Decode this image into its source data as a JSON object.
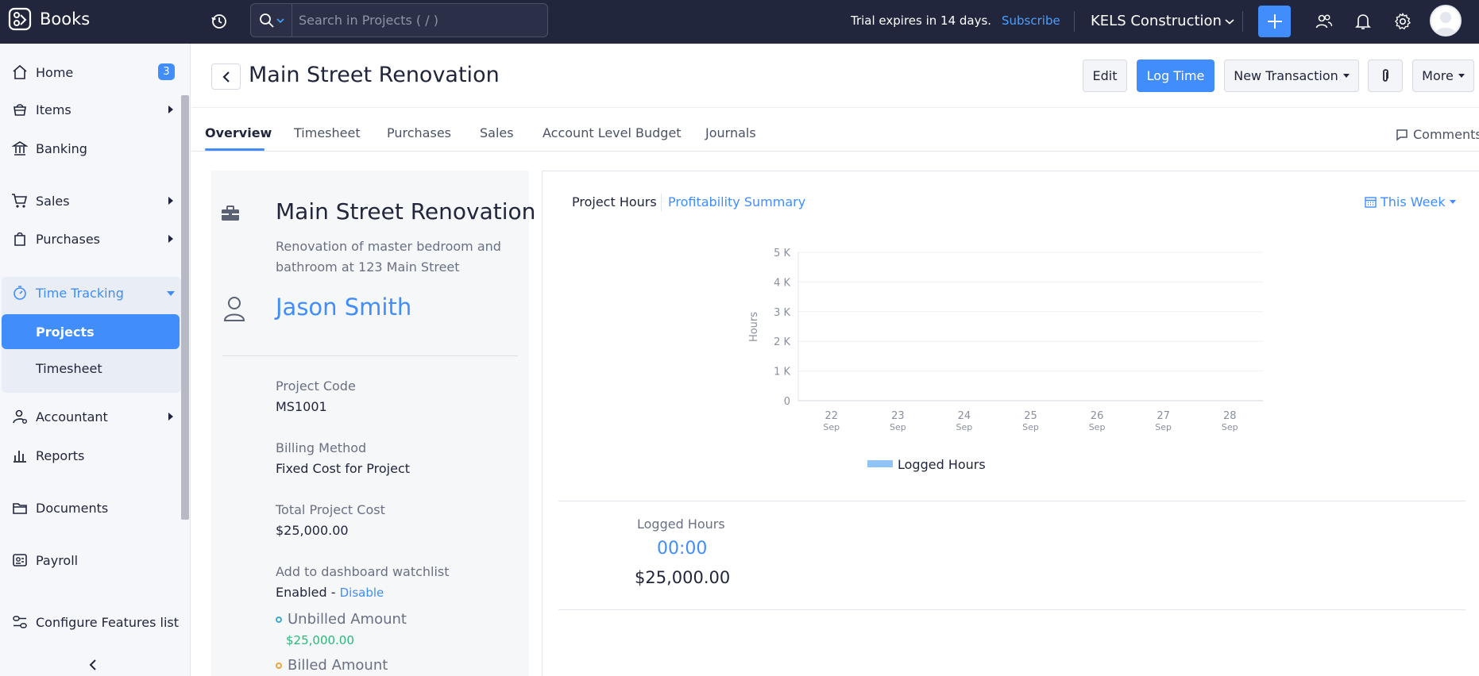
{
  "topbar": {
    "app_name": "Books",
    "search_placeholder": "Search in Projects ( / )",
    "trial_text": "Trial expires in 14 days.",
    "subscribe_label": "Subscribe",
    "org_name": "KELS Construction"
  },
  "sidebar": {
    "items": [
      {
        "label": "Home",
        "badge": "3"
      },
      {
        "label": "Items"
      },
      {
        "label": "Banking"
      },
      {
        "label": "Sales"
      },
      {
        "label": "Purchases"
      },
      {
        "label": "Time Tracking"
      },
      {
        "label": "Projects"
      },
      {
        "label": "Timesheet"
      },
      {
        "label": "Accountant"
      },
      {
        "label": "Reports"
      },
      {
        "label": "Documents"
      },
      {
        "label": "Payroll"
      },
      {
        "label": "Configure Features list"
      }
    ]
  },
  "header": {
    "title": "Main Street Renovation",
    "edit_label": "Edit",
    "log_time_label": "Log Time",
    "new_transaction_label": "New Transaction",
    "more_label": "More"
  },
  "tabs": [
    {
      "label": "Overview"
    },
    {
      "label": "Timesheet"
    },
    {
      "label": "Purchases"
    },
    {
      "label": "Sales"
    },
    {
      "label": "Account Level Budget"
    },
    {
      "label": "Journals"
    }
  ],
  "comments_label": "Comments",
  "project": {
    "name": "Main Street Renovation",
    "description": "Renovation of master bedroom and bathroom at 123 Main Street",
    "contact": "Jason Smith",
    "fields": [
      {
        "label": "Project Code",
        "value": "MS1001"
      },
      {
        "label": "Billing Method",
        "value": "Fixed Cost for Project"
      },
      {
        "label": "Total Project Cost",
        "value": "$25,000.00"
      },
      {
        "label": "Add to dashboard watchlist",
        "value": "Enabled - "
      }
    ],
    "disable_label": "Disable",
    "unbilled_label": "Unbilled Amount",
    "unbilled_value": "$25,000.00",
    "billed_label": "Billed Amount"
  },
  "chart_panel": {
    "tab_hours": "Project Hours",
    "tab_profit": "Profitability Summary",
    "range_label": "This Week"
  },
  "chart_data": {
    "type": "bar",
    "ylabel": "Hours",
    "xlabel": "",
    "categories": [
      "22 Sep",
      "23 Sep",
      "24 Sep",
      "25 Sep",
      "26 Sep",
      "27 Sep",
      "28 Sep"
    ],
    "cat_top": [
      "22",
      "23",
      "24",
      "25",
      "26",
      "27",
      "28"
    ],
    "cat_bottom": [
      "Sep",
      "Sep",
      "Sep",
      "Sep",
      "Sep",
      "Sep",
      "Sep"
    ],
    "y_ticks": [
      "0",
      "1 K",
      "2 K",
      "3 K",
      "4 K",
      "5 K"
    ],
    "ylim": [
      0,
      5000
    ],
    "series": [
      {
        "name": "Logged Hours",
        "values": [
          0,
          0,
          0,
          0,
          0,
          0,
          0
        ],
        "color": "#90c3f6"
      }
    ],
    "grid": true,
    "legend": "bottom"
  },
  "summary": {
    "label": "Logged Hours",
    "hours": "00:00",
    "amount": "$25,000.00"
  },
  "colors": {
    "accent": "#408dfb",
    "topbar": "#21263c",
    "unbilled": "#2bb77a",
    "billed": "#f0a33a"
  }
}
